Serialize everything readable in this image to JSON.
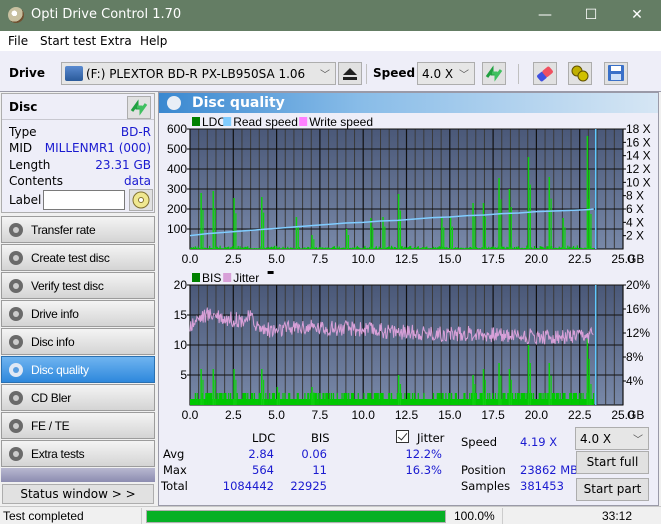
{
  "window": {
    "title": "Opti Drive Control 1.70",
    "minimize": "—",
    "maximize": "☐",
    "close": "✕"
  },
  "menu": [
    "File",
    "Start test",
    "Extra",
    "Help"
  ],
  "toolbar": {
    "drive_label": "Drive",
    "drive_value": "(F:)  PLEXTOR BD-R  PX-LB950SA 1.06",
    "speed_label": "Speed",
    "speed_value": "4.0 X"
  },
  "disc": {
    "header": "Disc",
    "rows": [
      {
        "key": "Type",
        "value": "BD-R"
      },
      {
        "key": "MID",
        "value": "MILLENMR1 (000)"
      },
      {
        "key": "Length",
        "value": "23.31 GB"
      },
      {
        "key": "Contents",
        "value": "data"
      }
    ],
    "label_key": "Label",
    "label_value": ""
  },
  "nav": [
    {
      "label": "Transfer rate",
      "active": false
    },
    {
      "label": "Create test disc",
      "active": false
    },
    {
      "label": "Verify test disc",
      "active": false
    },
    {
      "label": "Drive info",
      "active": false
    },
    {
      "label": "Disc info",
      "active": false
    },
    {
      "label": "Disc quality",
      "active": true
    },
    {
      "label": "CD Bler",
      "active": false
    },
    {
      "label": "FE / TE",
      "active": false
    },
    {
      "label": "Extra tests",
      "active": false
    }
  ],
  "status_window_label": "Status window > >",
  "panel_title": "Disc quality",
  "chart_data": [
    {
      "type": "bar",
      "title": "LDC / Read speed",
      "legend": [
        {
          "name": "LDC",
          "color": "#00c000"
        },
        {
          "name": "Read speed",
          "color": "#80ccff"
        },
        {
          "name": "Write speed",
          "color": "#ff80ff"
        }
      ],
      "xlabel": "GB",
      "xlim": [
        0,
        25
      ],
      "xticks": [
        "0.0",
        "2.5",
        "5.0",
        "7.5",
        "10.0",
        "12.5",
        "15.0",
        "17.5",
        "20.0",
        "22.5",
        "25.0"
      ],
      "ylim": [
        0,
        600
      ],
      "yticks": [
        "100",
        "200",
        "300",
        "400",
        "500",
        "600"
      ],
      "y2lim": [
        0,
        18
      ],
      "y2ticks": [
        "2 X",
        "4 X",
        "6 X",
        "8 X",
        "10 X",
        "12 X",
        "14 X",
        "16 X",
        "18 X"
      ],
      "end_marker_gb": 23.31,
      "ldc_spikes": [
        [
          0.6,
          280
        ],
        [
          1.3,
          290
        ],
        [
          2.5,
          255
        ],
        [
          4.1,
          260
        ],
        [
          6.1,
          160
        ],
        [
          7.0,
          70
        ],
        [
          9.0,
          100
        ],
        [
          10.4,
          155
        ],
        [
          11.1,
          160
        ],
        [
          12.0,
          275
        ],
        [
          13.4,
          10
        ],
        [
          14.5,
          155
        ],
        [
          15.0,
          160
        ],
        [
          16.3,
          230
        ],
        [
          16.9,
          230
        ],
        [
          17.8,
          355
        ],
        [
          18.4,
          300
        ],
        [
          19.5,
          460
        ],
        [
          20.7,
          360
        ],
        [
          21.5,
          155
        ],
        [
          22.9,
          565
        ],
        [
          23.0,
          250
        ]
      ],
      "read_speed": [
        [
          0,
          2.0
        ],
        [
          1,
          2.3
        ],
        [
          2,
          2.5
        ],
        [
          3,
          2.7
        ],
        [
          4,
          2.9
        ],
        [
          5,
          3.1
        ],
        [
          6,
          3.3
        ],
        [
          7,
          3.5
        ],
        [
          8,
          3.7
        ],
        [
          9,
          3.9
        ],
        [
          10,
          4.0
        ],
        [
          11,
          4.2
        ],
        [
          12,
          4.3
        ],
        [
          13,
          4.5
        ],
        [
          14,
          4.7
        ],
        [
          15,
          4.8
        ],
        [
          16,
          5.0
        ],
        [
          17,
          5.1
        ],
        [
          18,
          5.3
        ],
        [
          19,
          5.4
        ],
        [
          20,
          5.6
        ],
        [
          21,
          5.7
        ],
        [
          22,
          5.8
        ],
        [
          23,
          5.9
        ],
        [
          23.31,
          6.0
        ]
      ]
    },
    {
      "type": "bar",
      "title": "BIS / Jitter",
      "legend": [
        {
          "name": "BIS",
          "color": "#00c000"
        },
        {
          "name": "Jitter",
          "color": "#d8a0d8"
        }
      ],
      "xlabel": "GB",
      "xlim": [
        0,
        25
      ],
      "xticks": [
        "0.0",
        "2.5",
        "5.0",
        "7.5",
        "10.0",
        "12.5",
        "15.0",
        "17.5",
        "20.0",
        "22.5",
        "25.0"
      ],
      "ylim": [
        0,
        20
      ],
      "yticks": [
        "5",
        "10",
        "15",
        "20"
      ],
      "y2lim": [
        0,
        20
      ],
      "y2ticks": [
        "4%",
        "8%",
        "12%",
        "16%",
        "20%"
      ],
      "end_marker_gb": 23.31,
      "bis_spikes": [
        [
          0.6,
          6
        ],
        [
          1.3,
          6
        ],
        [
          2.5,
          6
        ],
        [
          4.1,
          6
        ],
        [
          5.0,
          3
        ],
        [
          7.0,
          3
        ],
        [
          12.0,
          5
        ],
        [
          16.3,
          5
        ],
        [
          16.9,
          6
        ],
        [
          17.8,
          7
        ],
        [
          18.4,
          6
        ],
        [
          19.5,
          10
        ],
        [
          20.7,
          7
        ],
        [
          22.9,
          11
        ],
        [
          23.0,
          5
        ]
      ],
      "jitter_trend": [
        [
          0,
          13.2
        ],
        [
          0.5,
          14.5
        ],
        [
          1,
          15.0
        ],
        [
          1.5,
          15.2
        ],
        [
          2,
          14.4
        ],
        [
          3,
          14.2
        ],
        [
          3.5,
          14.6
        ],
        [
          4,
          12.8
        ],
        [
          5,
          12.3
        ],
        [
          6,
          12.9
        ],
        [
          7,
          12.9
        ],
        [
          8,
          12.8
        ],
        [
          9,
          12.7
        ],
        [
          10,
          12.6
        ],
        [
          11,
          12.4
        ],
        [
          12,
          12.2
        ],
        [
          13,
          12.1
        ],
        [
          14,
          11.9
        ],
        [
          15,
          11.8
        ],
        [
          16,
          11.9
        ],
        [
          17,
          11.8
        ],
        [
          18,
          11.7
        ],
        [
          19,
          11.6
        ],
        [
          20,
          11.4
        ],
        [
          21,
          11.3
        ],
        [
          22,
          11.3
        ],
        [
          23,
          11.3
        ],
        [
          23.31,
          11.8
        ]
      ]
    }
  ],
  "stats": {
    "col_ldc": "LDC",
    "col_bis": "BIS",
    "jitter_label": "Jitter",
    "jitter_checked": true,
    "rows": [
      {
        "label": "Avg",
        "ldc": "2.84",
        "bis": "0.06",
        "jitter": "12.2%"
      },
      {
        "label": "Max",
        "ldc": "564",
        "bis": "11",
        "jitter": "16.3%"
      },
      {
        "label": "Total",
        "ldc": "1084442",
        "bis": "22925",
        "jitter": ""
      }
    ],
    "speed_label": "Speed",
    "speed_value": "4.19 X",
    "position_label": "Position",
    "position_value": "23862 MB",
    "samples_label": "Samples",
    "samples_value": "381453",
    "speed_select": "4.0 X",
    "start_full": "Start full",
    "start_part": "Start part"
  },
  "statusbar": {
    "text": "Test completed",
    "progress_percent": 100,
    "progress_label": "100.0%",
    "time": "33:12"
  }
}
